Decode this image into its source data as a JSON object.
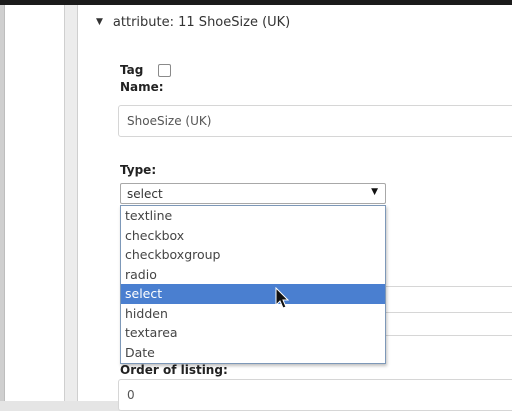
{
  "section": {
    "header": "attribute: 11 ShoeSize (UK)"
  },
  "fields": {
    "tag_label": "Tag",
    "name_label": "Name:",
    "name_value": "ShoeSize (UK)",
    "type_label": "Type:",
    "type_selected": "select",
    "order_label": "Order of listing:",
    "order_value": "0"
  },
  "type_options": [
    "textline",
    "checkbox",
    "checkboxgroup",
    "radio",
    "select",
    "hidden",
    "textarea",
    "Date"
  ],
  "type_highlighted": "select",
  "icons": {
    "expand": "triangle-down-icon",
    "dropdown": "caret-down-icon",
    "pointer": "mouse-pointer-icon"
  },
  "colors": {
    "highlight": "#4a7fd0",
    "topbar": "#1b1b1b"
  }
}
